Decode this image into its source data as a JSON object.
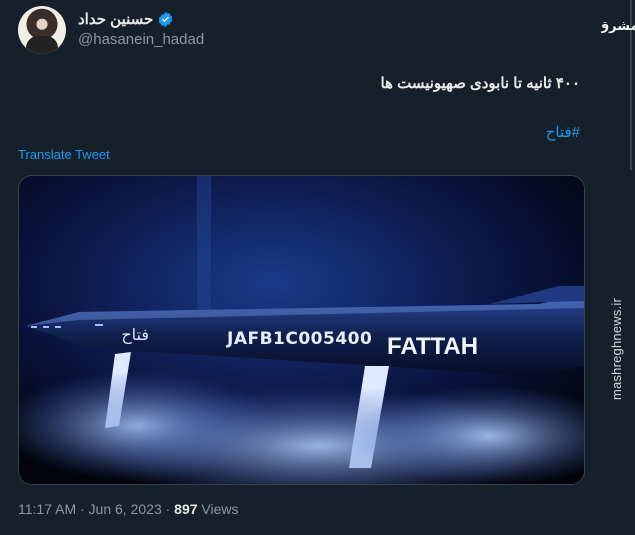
{
  "tweet": {
    "display_name": "حسنین حداد",
    "handle": "@hasanein_hadad",
    "text": "۴۰۰ ثانیه تا نابودی صهیونیست ها",
    "hashtag": "#فتاح",
    "translate_label": "Translate Tweet",
    "timestamp": "11:17 AM · Jun 6, 2023 · ",
    "views_count": "897",
    "views_label": " Views"
  },
  "media": {
    "inscription_persian": "فتاح",
    "serial": "JAFB1C005400",
    "name": "FATTAH"
  },
  "watermark": {
    "site": "mashreghnews.ir",
    "logo_text": "مشرق"
  },
  "colors": {
    "background": "#15202b",
    "link": "#1d9bf0",
    "verified": "#1d9bf0"
  },
  "icons": [
    "verified-badge-icon",
    "mashregh-logo-icon"
  ]
}
